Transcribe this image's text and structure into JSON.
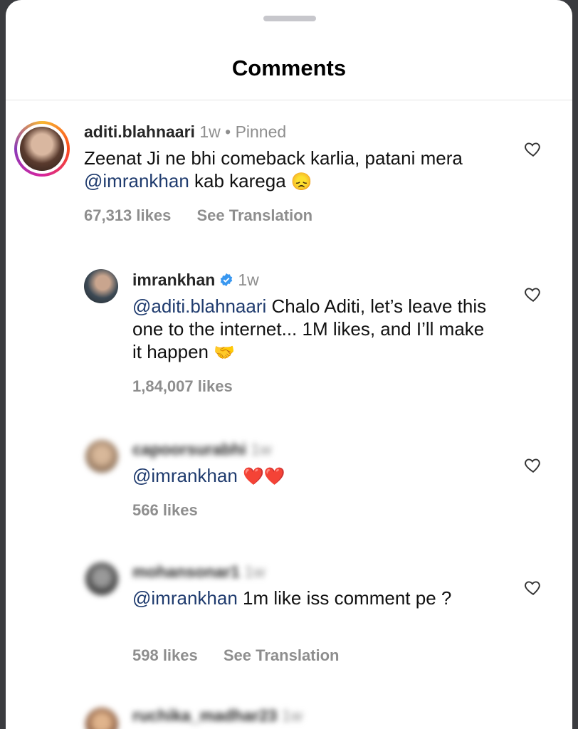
{
  "header": {
    "title": "Comments"
  },
  "comments": [
    {
      "username": "aditi.blahnaari",
      "time": "1w",
      "pinned_label": "• Pinned",
      "mention": "",
      "text_before": "Zeenat Ji ne bhi comeback karlia, patani mera ",
      "text_mention": "@imrankhan",
      "text_after": " kab karega",
      "emoji": "😞",
      "likes": "67,313 likes",
      "translate": "See Translation"
    },
    {
      "username": "imrankhan",
      "time": "1w",
      "text_mention": "@aditi.blahnaari",
      "text_after": " Chalo Aditi, let’s leave this one to the internet... 1M likes, and I’ll make it happen",
      "emoji": "🤝",
      "likes": "1,84,007 likes"
    },
    {
      "username": "capoorsurabhi",
      "time": "1w",
      "text_mention": "@imrankhan",
      "emoji": "❤️❤️",
      "likes": "566 likes"
    },
    {
      "username": "mohansonar1",
      "time": "1w",
      "text_mention": "@imrankhan",
      "text_after": " 1m like iss comment pe ?",
      "likes": "598 likes",
      "translate": "See Translation"
    },
    {
      "username": "ruchika_madhar23",
      "time": "1w"
    }
  ],
  "colors": {
    "mention": "#1f3b6e",
    "secondary": "#8e8e8e",
    "verified": "#3897f0"
  }
}
